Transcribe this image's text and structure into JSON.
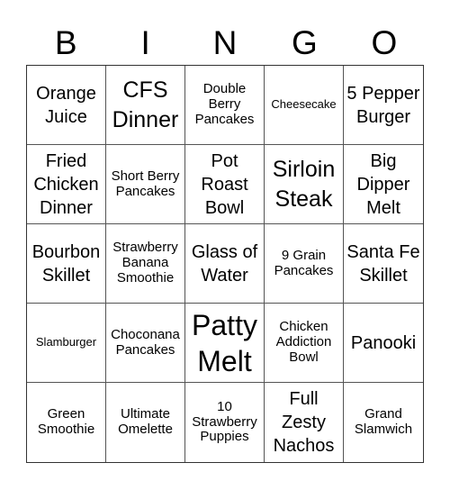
{
  "header": {
    "letters": [
      "B",
      "I",
      "N",
      "G",
      "O"
    ]
  },
  "cells": [
    {
      "text": "Orange Juice",
      "size": "s-m"
    },
    {
      "text": "CFS Dinner",
      "size": "s-l"
    },
    {
      "text": "Double Berry Pancakes",
      "size": "s-s"
    },
    {
      "text": "Cheesecake",
      "size": "s-xs"
    },
    {
      "text": "5 Pepper Burger",
      "size": "s-m"
    },
    {
      "text": "Fried Chicken Dinner",
      "size": "s-m"
    },
    {
      "text": "Short Berry Pancakes",
      "size": "s-s"
    },
    {
      "text": "Pot Roast Bowl",
      "size": "s-m"
    },
    {
      "text": "Sirloin Steak",
      "size": "s-l"
    },
    {
      "text": "Big Dipper Melt",
      "size": "s-m"
    },
    {
      "text": "Bourbon Skillet",
      "size": "s-m"
    },
    {
      "text": "Strawberry Banana Smoothie",
      "size": "s-s"
    },
    {
      "text": "Glass of Water",
      "size": "s-m"
    },
    {
      "text": "9 Grain Pancakes",
      "size": "s-s"
    },
    {
      "text": "Santa Fe Skillet",
      "size": "s-m"
    },
    {
      "text": "Slamburger",
      "size": "s-xs"
    },
    {
      "text": "Choconana Pancakes",
      "size": "s-s"
    },
    {
      "text": "Patty Melt",
      "size": "s-xl"
    },
    {
      "text": "Chicken Addiction Bowl",
      "size": "s-s"
    },
    {
      "text": "Panooki",
      "size": "s-m"
    },
    {
      "text": "Green Smoothie",
      "size": "s-s"
    },
    {
      "text": "Ultimate Omelette",
      "size": "s-s"
    },
    {
      "text": "10 Strawberry Puppies",
      "size": "s-s"
    },
    {
      "text": "Full Zesty Nachos",
      "size": "s-m"
    },
    {
      "text": "Grand Slamwich",
      "size": "s-s"
    }
  ]
}
